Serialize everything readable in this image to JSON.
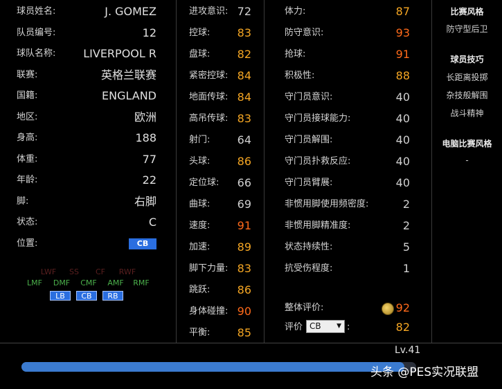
{
  "basic": {
    "rows": [
      {
        "label": "球员姓名:",
        "value": "J. GOMEZ"
      },
      {
        "label": "队员编号:",
        "value": "12"
      },
      {
        "label": "球队名称:",
        "value": "LIVERPOOL R"
      },
      {
        "label": "联赛:",
        "value": "英格兰联赛"
      },
      {
        "label": "国籍:",
        "value": "ENGLAND"
      },
      {
        "label": "地区:",
        "value": "欧洲"
      },
      {
        "label": "身高:",
        "value": "188"
      },
      {
        "label": "体重:",
        "value": "77"
      },
      {
        "label": "年龄:",
        "value": "22"
      },
      {
        "label": "脚:",
        "value": "右脚"
      },
      {
        "label": "状态:",
        "value": "C"
      }
    ],
    "position_label": "位置:",
    "position_value": "CB"
  },
  "position_map": {
    "top_row": [
      "LWF",
      "SS",
      "CF",
      "RWF"
    ],
    "mid_row": [
      "LMF",
      "DMF",
      "CMF",
      "AMF",
      "RMF"
    ],
    "bottom_row": [
      "LB",
      "CB",
      "RB"
    ]
  },
  "attrs_mid": [
    {
      "label": "进攻意识:",
      "value": "72"
    },
    {
      "label": "控球:",
      "value": "83"
    },
    {
      "label": "盘球:",
      "value": "82"
    },
    {
      "label": "紧密控球:",
      "value": "84"
    },
    {
      "label": "地面传球:",
      "value": "84"
    },
    {
      "label": "高吊传球:",
      "value": "83"
    },
    {
      "label": "射门:",
      "value": "64"
    },
    {
      "label": "头球:",
      "value": "86"
    },
    {
      "label": "定位球:",
      "value": "66"
    },
    {
      "label": "曲球:",
      "value": "69"
    },
    {
      "label": "速度:",
      "value": "91"
    },
    {
      "label": "加速:",
      "value": "89"
    },
    {
      "label": "脚下力量:",
      "value": "83"
    },
    {
      "label": "跳跃:",
      "value": "86"
    },
    {
      "label": "身体碰撞:",
      "value": "90"
    },
    {
      "label": "平衡:",
      "value": "85"
    }
  ],
  "attrs_right": [
    {
      "label": "体力:",
      "value": "87"
    },
    {
      "label": "防守意识:",
      "value": "93"
    },
    {
      "label": "抢球:",
      "value": "91"
    },
    {
      "label": "积极性:",
      "value": "88"
    },
    {
      "label": "守门员意识:",
      "value": "40"
    },
    {
      "label": "守门员接球能力:",
      "value": "40"
    },
    {
      "label": "守门员解围:",
      "value": "40"
    },
    {
      "label": "守门员扑救反应:",
      "value": "40"
    },
    {
      "label": "守门员臂展:",
      "value": "40"
    },
    {
      "label": "非惯用脚使用频密度:",
      "value": "2"
    },
    {
      "label": "非惯用脚精准度:",
      "value": "2"
    },
    {
      "label": "状态持续性:",
      "value": "5"
    },
    {
      "label": "抗受伤程度:",
      "value": "1"
    }
  ],
  "overall": {
    "label": "整体评价:",
    "value": "92"
  },
  "rating": {
    "label": "评价",
    "select_value": "CB",
    "suffix": ":",
    "value": "82"
  },
  "side": {
    "style_heading": "比赛风格",
    "style_value": "防守型后卫",
    "skills_heading": "球员技巧",
    "skills": [
      "长距离投掷",
      "杂技般解围",
      "战斗精神"
    ],
    "ai_heading": "电脑比赛风格",
    "ai_value": "-"
  },
  "level": {
    "label": "Lv.41",
    "progress": 0.97
  },
  "watermark": "头条 @PES实况联盟",
  "colors": {
    "high": "#f5a623",
    "very_high": "#ff6a1a",
    "badge": "#2a6ee0",
    "bar": "#3b7bd0"
  }
}
